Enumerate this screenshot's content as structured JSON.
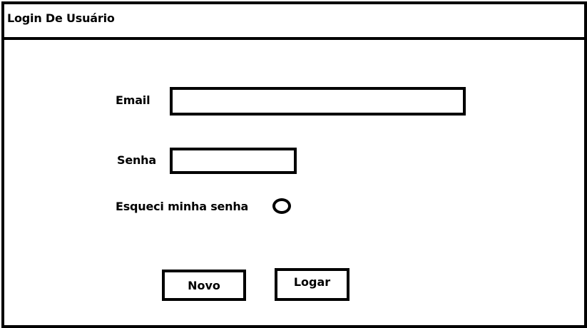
{
  "window": {
    "title": "Login De Usuário"
  },
  "form": {
    "email_label": "Email",
    "email_value": "",
    "password_label": "Senha",
    "password_value": "",
    "forgot_label": "Esqueci minha senha",
    "forgot_selected": false
  },
  "actions": {
    "new_label": "Novo",
    "login_label": "Logar"
  }
}
